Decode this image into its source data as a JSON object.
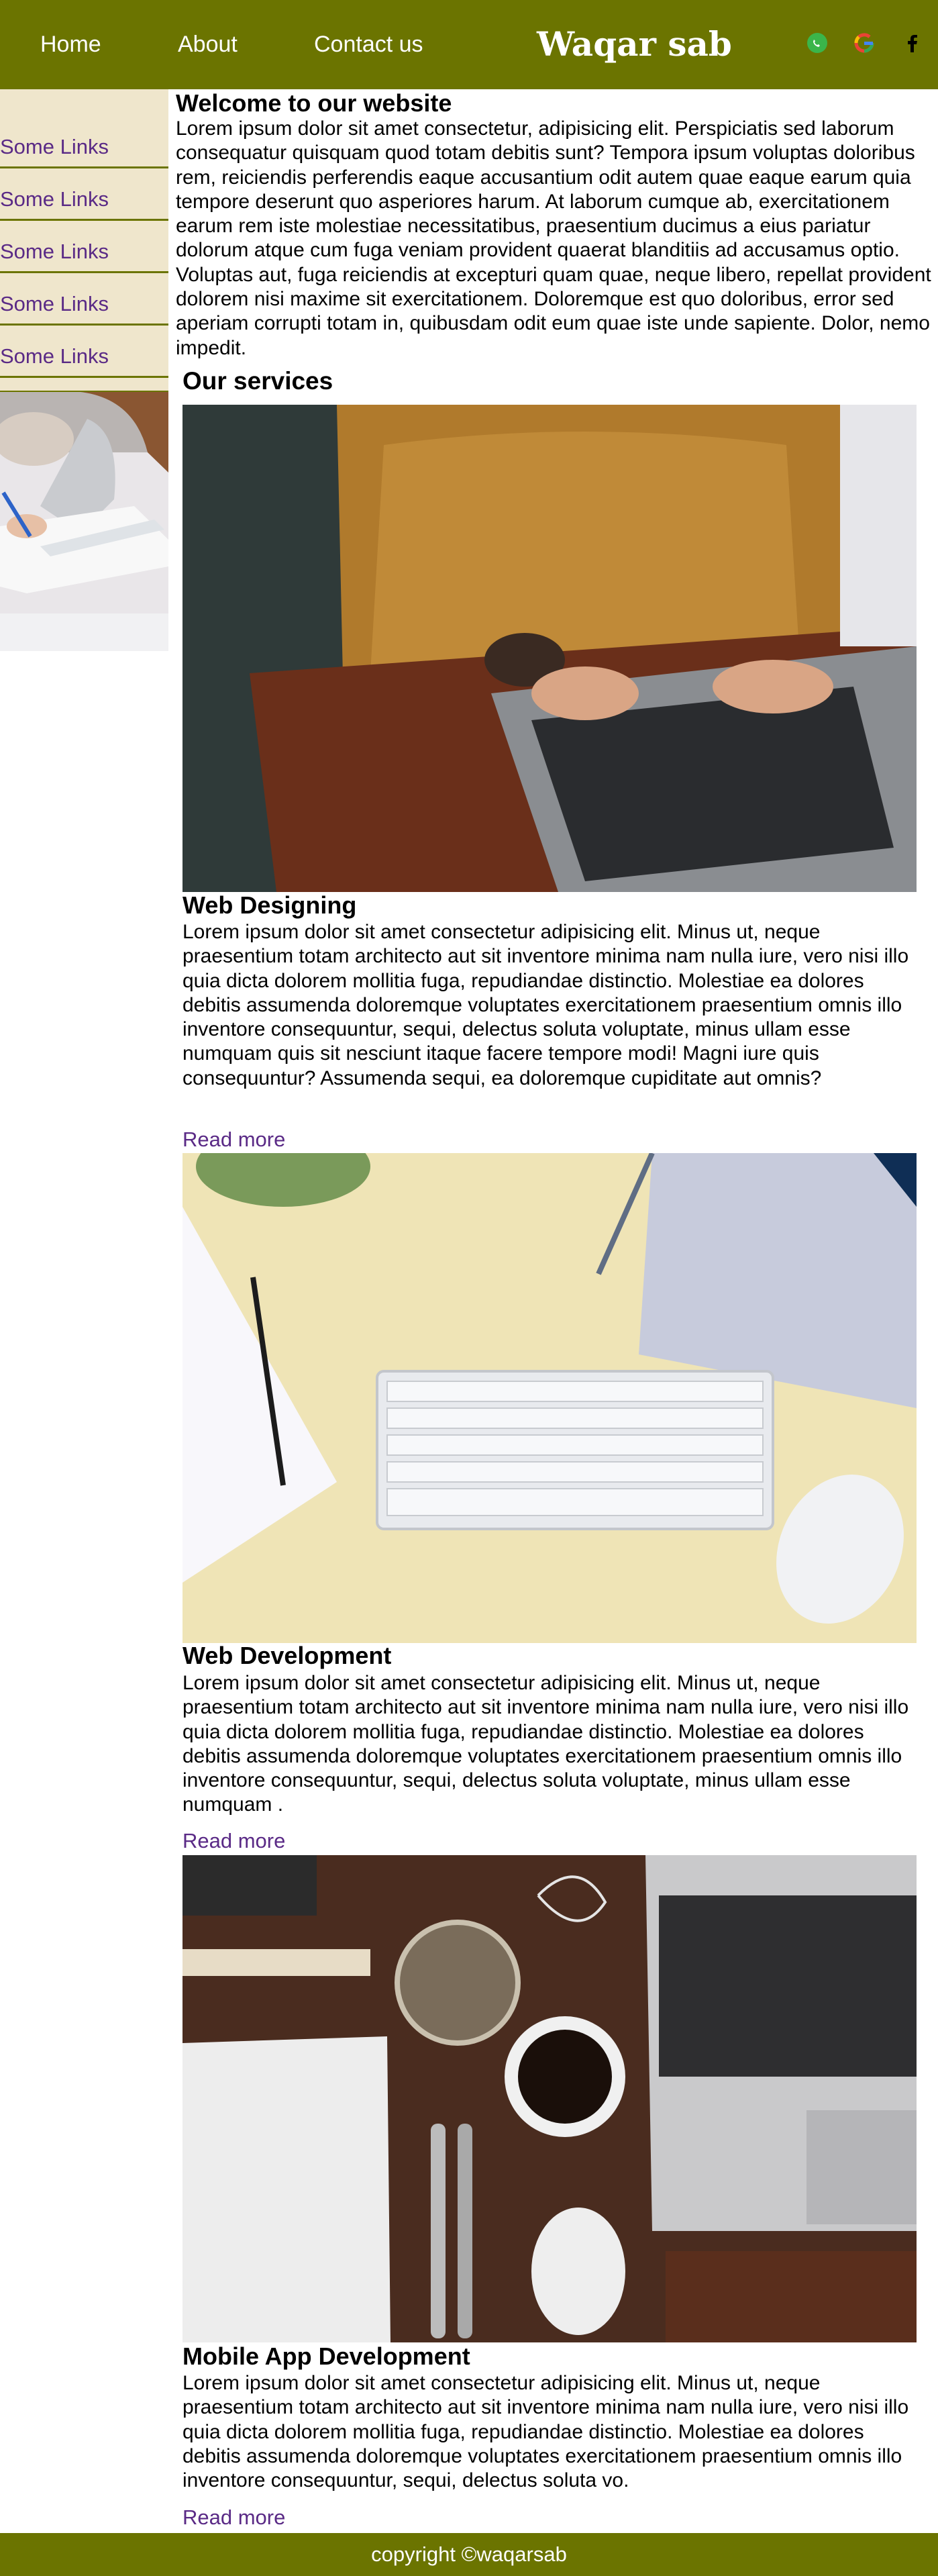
{
  "nav": {
    "home": "Home",
    "about": "About",
    "contact": "Contact us",
    "brand": "Waqar sab",
    "social_icons": [
      "whatsapp-icon",
      "google-icon",
      "facebook-icon"
    ]
  },
  "sidebar": {
    "links": [
      "Some Links",
      "Some Links",
      "Some Links",
      "Some Links",
      "Some Links"
    ]
  },
  "welcome": {
    "title": "Welcome to our website",
    "text": "Lorem ipsum dolor sit amet consectetur, adipisicing elit. Perspiciatis sed laborum consequatur quisquam quod totam debitis sunt? Tempora ipsum voluptas doloribus rem, reiciendis perferendis eaque accusantium odit autem quae eaque earum quia tempore deserunt quo asperiores harum. At laborum cumque ab, exercitationem earum rem iste molestiae necessitatibus, praesentium ducimus a eius pariatur dolorum atque cum fuga veniam provident quaerat blanditiis ad accusamus optio. Voluptas aut, fuga reiciendis at excepturi quam quae, neque libero, repellat provident dolorem nisi maxime sit exercitationem. Doloremque est quo doloribus, error sed aperiam corrupti totam in, quibusdam odit eum quae iste unde sapiente. Dolor, nemo impedit."
  },
  "services": {
    "title": "Our services",
    "items": [
      {
        "title": "Web Designing",
        "text": "Lorem ipsum dolor sit amet consectetur adipisicing elit. Minus ut, neque praesentium totam architecto aut sit inventore minima nam nulla iure, vero nisi illo quia dicta dolorem mollitia fuga, repudiandae distinctio. Molestiae ea dolores debitis assumenda doloremque voluptates exercitationem praesentium omnis illo inventore consequuntur, sequi, delectus soluta voluptate, minus ullam esse numquam quis sit nesciunt itaque facere tempore modi! Magni iure quis consequuntur? Assumenda sequi, ea doloremque cupiditate aut omnis?",
        "link": "Read more"
      },
      {
        "title": "Web Development",
        "text": "Lorem ipsum dolor sit amet consectetur adipisicing elit. Minus ut, neque praesentium totam architecto aut sit inventore minima nam nulla iure, vero nisi illo quia dicta dolorem mollitia fuga, repudiandae distinctio. Molestiae ea dolores debitis assumenda doloremque voluptates exercitationem praesentium omnis illo inventore consequuntur, sequi, delectus soluta voluptate, minus ullam esse numquam .",
        "link": "Read more"
      },
      {
        "title": "Mobile App Development",
        "text": "Lorem ipsum dolor sit amet consectetur adipisicing elit. Minus ut, neque praesentium totam architecto aut sit inventore minima nam nulla iure, vero nisi illo quia dicta dolorem mollitia fuga, repudiandae distinctio. Molestiae ea dolores debitis assumenda doloremque voluptates exercitationem praesentium omnis illo inventore consequuntur, sequi, delectus soluta vo.",
        "link": "Read more"
      }
    ]
  },
  "footer": {
    "text": "copyright ©waqarsab"
  },
  "colors": {
    "header_bg": "#6b7400",
    "sidebar_bg": "#efe6cc",
    "link": "#5a2a86"
  }
}
